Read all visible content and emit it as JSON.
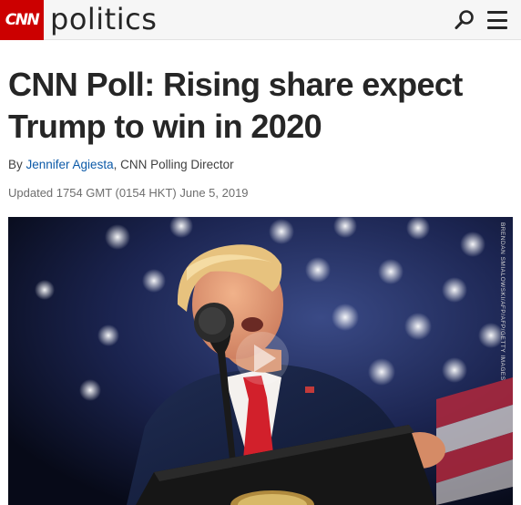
{
  "header": {
    "logo_text": "CNN",
    "section": "politics",
    "search_icon": "search-icon",
    "menu_icon": "hamburger-menu-icon",
    "accent_color": "#cc0000"
  },
  "article": {
    "headline": "CNN Poll: Rising share expect Trump to win in 2020",
    "byline_prefix": "By ",
    "author": "Jennifer Agiesta",
    "author_title": ", CNN Polling Director",
    "updated": "Updated 1754 GMT (0154 HKT) June 5, 2019",
    "link_color": "#0c5aa8"
  },
  "media": {
    "photo_credit": "BRENDAN SMIALOWSKI/AFP/AFP/GETTY IMAGES",
    "play_icon": "play-icon"
  }
}
